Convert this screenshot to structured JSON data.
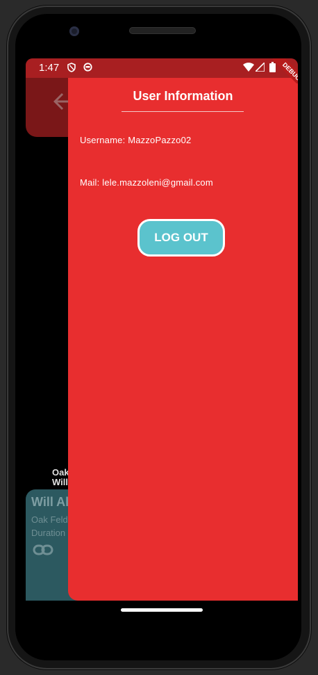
{
  "status_bar": {
    "time": "1:47",
    "icons": [
      "shield-icon",
      "circle-icon",
      "wifi-icon",
      "signal-icon",
      "battery-icon"
    ],
    "color": "#a81f21"
  },
  "debug_banner": {
    "label": "DEBUG"
  },
  "background_screen": {
    "line1": "Oak",
    "line2": "Will",
    "card_title": "Will Al",
    "card_line1": "Oak Feld",
    "card_line2": "Duration",
    "card_color": "#2c5960"
  },
  "drawer": {
    "title": "User Information",
    "username_label": "Username: MazzoPazzo02",
    "mail_label": "Mail: lele.mazzoleni@gmail.com",
    "logout_label": "LOG OUT",
    "background_color": "#e82e2f",
    "button_color": "#5bc3cd"
  }
}
